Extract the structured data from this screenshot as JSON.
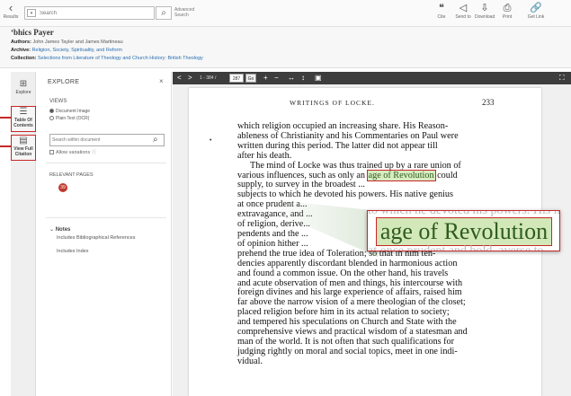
{
  "toolbar": {
    "results_label": "Results",
    "search_placeholder": "Search",
    "advanced_search": "Advanced Search",
    "tools": [
      {
        "icon": "cite-icon",
        "glyph": "❝",
        "label": "Cite"
      },
      {
        "icon": "send-to-icon",
        "glyph": "◁",
        "label": "Send to"
      },
      {
        "icon": "download-icon",
        "glyph": "⇩",
        "label": "Download"
      },
      {
        "icon": "print-icon",
        "glyph": "⎙",
        "label": "Print"
      },
      {
        "icon": "get-link-icon",
        "glyph": "🔗",
        "label": "Get Link"
      }
    ]
  },
  "metadata": {
    "title": "ʻbhics Payer",
    "authors_label": "Authors:",
    "authors_value": "John James Tayler and James Martineau",
    "archive_label": "Archive:",
    "archive_value": "Religion, Society, Spirituality, and Reform",
    "collection_label": "Collection:",
    "collection_value": "Selections from Literature of Theology and Church History: British Theology"
  },
  "rail": {
    "explore": "Explore",
    "table_of_contents": "Table Of Contents",
    "view_full_citation": "View Full Citation"
  },
  "explore": {
    "title": "EXPLORE",
    "close": "×",
    "views_label": "VIEWS",
    "view_document_image": "Document Image",
    "view_plain_text": "Plain Text (OCR)",
    "search_within_placeholder": "Search within document",
    "allow_variations": "Allow variations",
    "relevant_pages_label": "RELEVANT PAGES",
    "relevant_count": "39",
    "notes_label": "Notes",
    "notes_items": [
      "Includes Bibliographical References",
      "Includes Index"
    ]
  },
  "viewer": {
    "prev": "<",
    "next": ">",
    "page_range": "1 - 384 /",
    "page_value": "287",
    "go": "Go",
    "zoom_in": "+",
    "zoom_out": "−",
    "fit_width": "↔",
    "fit_height": "↕",
    "image_view": "▣",
    "fullscreen": "⛶",
    "running_head": "WRITINGS OF LOCKE.",
    "page_number": "233",
    "lines_p1": [
      "which religion occupied an increasing share.  His Reason-",
      "ableness of Christianity and his Commentaries on Paul were",
      "written during this period.  The latter did not appear till",
      "after his death."
    ],
    "p2_line1": "The mind of Locke was thus trained up by a rare union of",
    "p2_line2_before": "various influences, such as only an ",
    "highlight": "age of Revolution",
    "p2_line2_after": " could",
    "lines_p2_rest": [
      "supply, to survey in the broadest ...",
      "subjects to which he devoted his powers.  His native genius",
      "at once prudent a...",
      "extravagance, and ...",
      "of religion, derive...",
      "pendents and the ...",
      "of opinion hither ...",
      "prehend the true idea of Toleration; so that in him ten-",
      "dencies apparently discordant blended in harmonious action",
      "and found a common issue.  On the other hand, his travels",
      "and acute observation of men and things, his intercourse with",
      "foreign divines and his large experience of affairs, raised him",
      "far above the narrow vision of a mere theologian of the closet;",
      "placed religion before him in its actual relation to society;",
      "and tempered his speculations on Church and State with the",
      "comprehensive views and practical wisdom of a statesman and",
      "man of the world.  It is not often that such qualifications for",
      "judging rightly on moral and social topics, meet in one indi-",
      "vidual."
    ],
    "zoom_text": "age of Revolution",
    "zoom_top_ghost": "to which he devoted his powers. His native genius",
    "zoom_bottom_ghost": "at once prudent and bold, averse to"
  },
  "colors": {
    "accent_red": "#c62828",
    "highlight_green": "#d2e8b8",
    "viewer_bar": "#3d3d3d",
    "link_blue": "#2a6fb0"
  }
}
